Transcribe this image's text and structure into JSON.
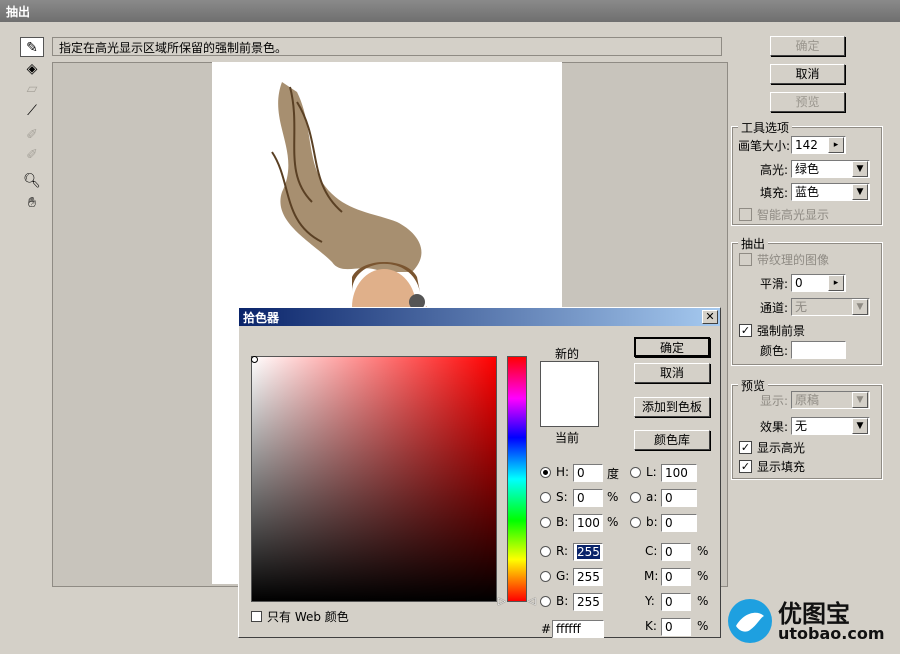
{
  "window": {
    "title": "抽出"
  },
  "hint": "指定在高光显示区域所保留的强制前景色。",
  "buttons": {
    "ok": "确定",
    "cancel": "取消",
    "preview": "预览"
  },
  "tool_options": {
    "title": "工具选项",
    "brush_size_label": "画笔大小:",
    "brush_size_value": "142",
    "highlight_label": "高光:",
    "highlight_value": "绿色",
    "fill_label": "填充:",
    "fill_value": "蓝色",
    "smart_highlight_label": "智能高光显示"
  },
  "extraction": {
    "title": "抽出",
    "textured_image_label": "带纹理的图像",
    "smooth_label": "平滑:",
    "smooth_value": "0",
    "channel_label": "通道:",
    "channel_value": "无",
    "force_fg_label": "强制前景",
    "color_label": "颜色:"
  },
  "preview": {
    "title": "预览",
    "show_label": "显示:",
    "show_value": "原稿",
    "effect_label": "效果:",
    "effect_value": "无",
    "show_highlight_label": "显示高光",
    "show_fill_label": "显示填充"
  },
  "picker": {
    "title": "拾色器",
    "new_label": "新的",
    "current_label": "当前",
    "ok": "确定",
    "cancel": "取消",
    "add_swatch": "添加到色板",
    "color_library": "颜色库",
    "web_only_label": "只有 Web 颜色",
    "H": "0",
    "H_unit": "度",
    "S": "0",
    "S_unit": "%",
    "B": "100",
    "B_unit": "%",
    "R": "255",
    "G": "255",
    "Bl": "255",
    "L": "100",
    "a": "0",
    "b": "0",
    "C": "0",
    "M": "0",
    "Y": "0",
    "K": "0",
    "hex_label": "#",
    "hex": "ffffff",
    "new_color": "#ffffff",
    "current_color": "#ffffff"
  },
  "watermark": {
    "name": "优图宝",
    "url": "utobao.com"
  }
}
